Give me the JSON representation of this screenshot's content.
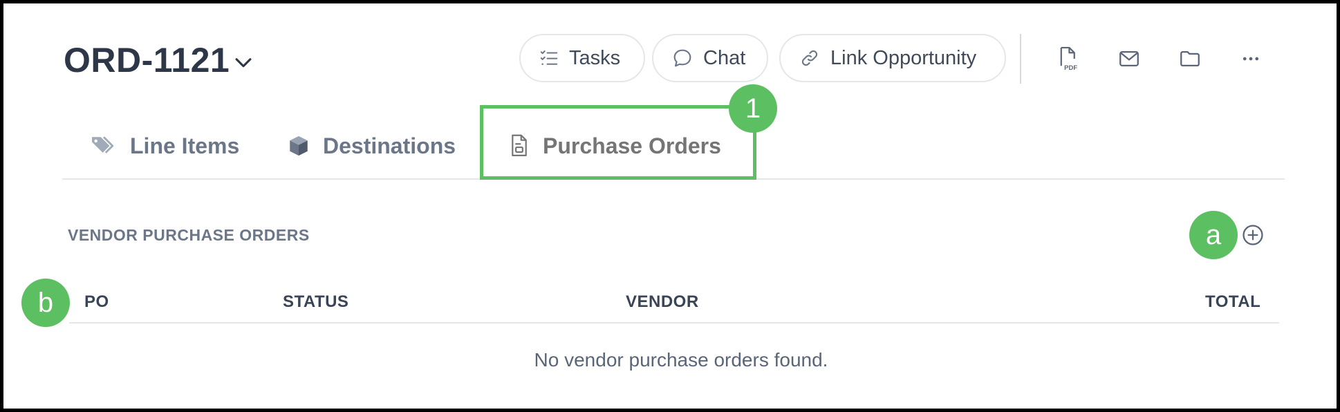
{
  "header": {
    "order_id": "ORD-1121",
    "actions": {
      "tasks": "Tasks",
      "chat": "Chat",
      "link_opportunity": "Link Opportunity"
    },
    "icon_buttons": [
      "pdf-icon",
      "mail-icon",
      "folder-icon",
      "more-icon"
    ]
  },
  "tabs": [
    {
      "label": "Line Items",
      "icon": "tags-icon"
    },
    {
      "label": "Destinations",
      "icon": "box-icon"
    },
    {
      "label": "Purchase Orders",
      "icon": "document-icon",
      "active": true
    }
  ],
  "annotations": {
    "tab_marker": "1",
    "add_marker": "a",
    "table_marker": "b"
  },
  "section": {
    "title": "VENDOR PURCHASE ORDERS",
    "columns": [
      "PO",
      "STATUS",
      "VENDOR",
      "TOTAL"
    ],
    "empty_message": "No vendor purchase orders found."
  },
  "colors": {
    "annotation_green": "#5cbf61",
    "text_dark": "#2d3748",
    "text_muted": "#6b7789"
  }
}
